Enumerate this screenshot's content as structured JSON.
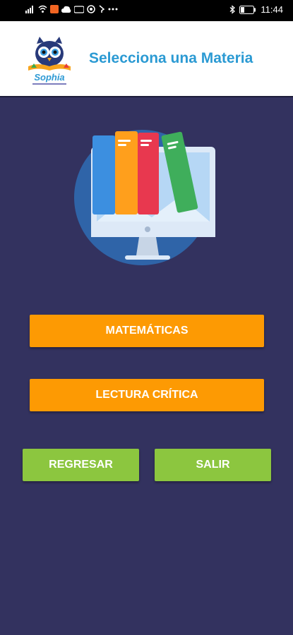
{
  "status_bar": {
    "time": "11:44",
    "icons": [
      "signal-icon",
      "wifi-icon",
      "notification-icon",
      "cloud-icon",
      "vpn-icon",
      "circle-icon",
      "more-dots-icon",
      "bluetooth-icon",
      "battery-icon"
    ]
  },
  "header": {
    "logo_text": "Sophia",
    "title": "Selecciona una Materia"
  },
  "buttons": {
    "matematicas": "MATEMÁTICAS",
    "lectura": "LECTURA CRÍTICA",
    "regresar": "REGRESAR",
    "salir": "SALIR"
  },
  "colors": {
    "background": "#33325f",
    "accent_orange": "#fd9a03",
    "accent_green": "#8cc63f",
    "title_blue": "#2b9ad3"
  }
}
